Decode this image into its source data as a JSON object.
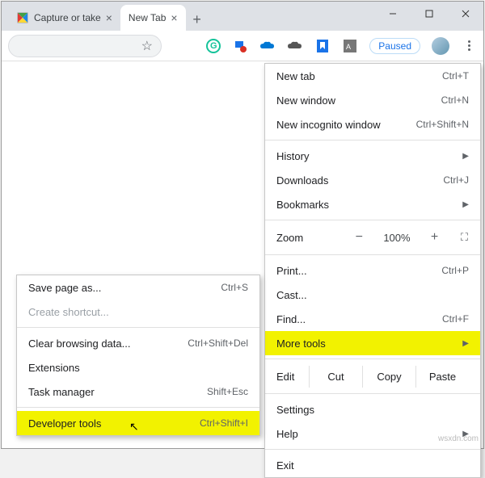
{
  "tabs": {
    "inactive_title": "Capture or take",
    "active_title": "New Tab"
  },
  "toolbar": {
    "paused": "Paused"
  },
  "menu": {
    "new_tab": "New tab",
    "new_tab_k": "Ctrl+T",
    "new_window": "New window",
    "new_window_k": "Ctrl+N",
    "incognito": "New incognito window",
    "incognito_k": "Ctrl+Shift+N",
    "history": "History",
    "downloads": "Downloads",
    "downloads_k": "Ctrl+J",
    "bookmarks": "Bookmarks",
    "zoom": "Zoom",
    "zoom_val": "100%",
    "print": "Print...",
    "print_k": "Ctrl+P",
    "cast": "Cast...",
    "find": "Find...",
    "find_k": "Ctrl+F",
    "more_tools": "More tools",
    "edit": "Edit",
    "cut": "Cut",
    "copy": "Copy",
    "paste": "Paste",
    "settings": "Settings",
    "help": "Help",
    "exit": "Exit"
  },
  "submenu": {
    "save_page": "Save page as...",
    "save_page_k": "Ctrl+S",
    "create_shortcut": "Create shortcut...",
    "clear_data": "Clear browsing data...",
    "clear_data_k": "Ctrl+Shift+Del",
    "extensions": "Extensions",
    "task_manager": "Task manager",
    "task_manager_k": "Shift+Esc",
    "dev_tools": "Developer tools",
    "dev_tools_k": "Ctrl+Shift+I"
  },
  "watermark": "wsxdn.com"
}
